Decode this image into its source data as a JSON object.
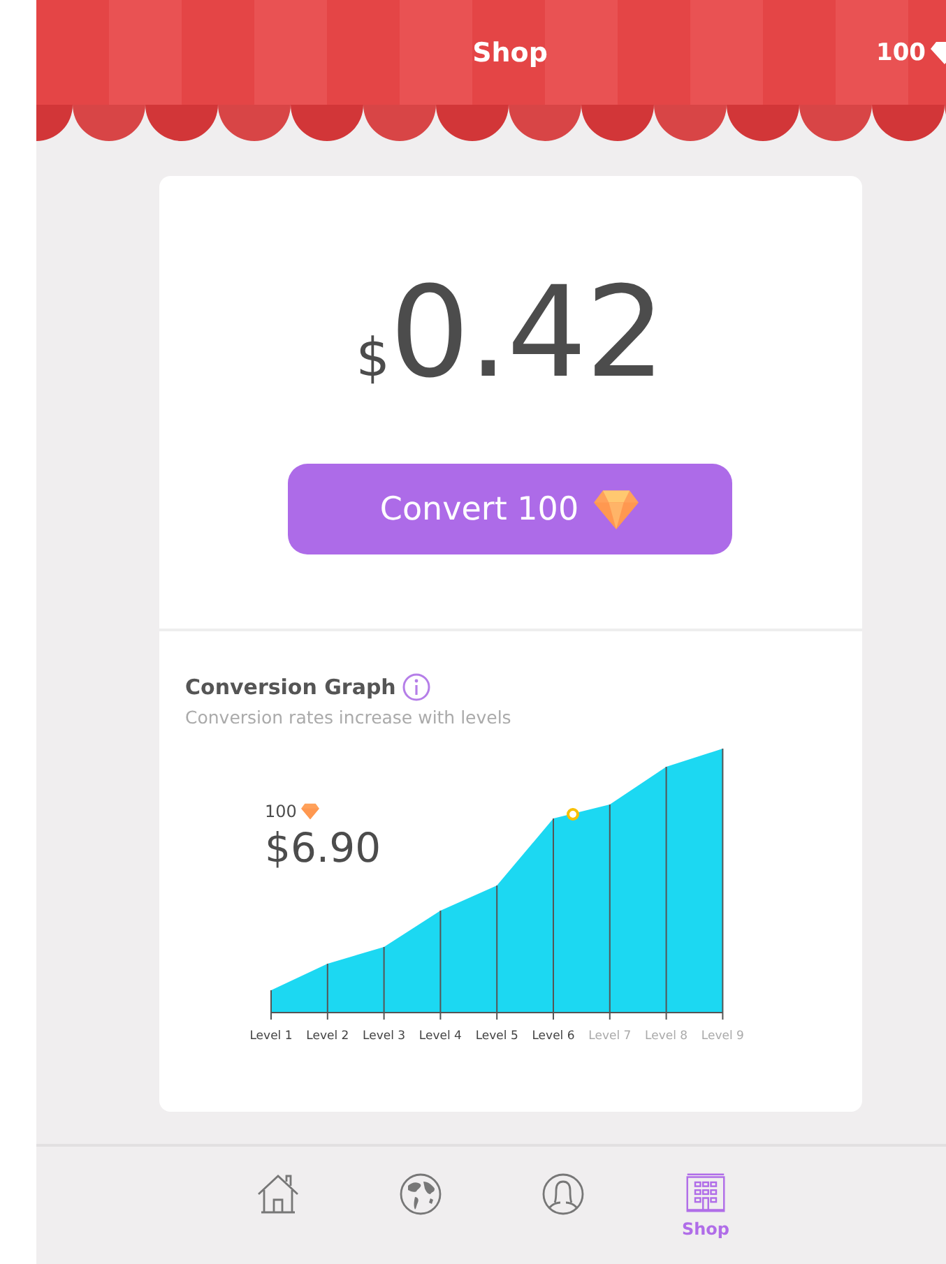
{
  "header": {
    "title": "Shop",
    "balance": "100"
  },
  "price": {
    "currency": "$",
    "amount": "0.42"
  },
  "convert_button": {
    "label": "Convert 100"
  },
  "graph": {
    "title": "Conversion Graph",
    "subtitle": "Conversion rates increase with levels",
    "callout_amount": "100",
    "callout_value": "$6.90",
    "levels": [
      {
        "label": "Level 1",
        "unlocked": true
      },
      {
        "label": "Level 2",
        "unlocked": true
      },
      {
        "label": "Level 3",
        "unlocked": true
      },
      {
        "label": "Level 4",
        "unlocked": true
      },
      {
        "label": "Level 5",
        "unlocked": true
      },
      {
        "label": "Level 6",
        "unlocked": true
      },
      {
        "label": "Level 7",
        "unlocked": false
      },
      {
        "label": "Level 8",
        "unlocked": false
      },
      {
        "label": "Level 9",
        "unlocked": false
      }
    ]
  },
  "nav": [
    {
      "kind": "home",
      "selected": false
    },
    {
      "kind": "globe",
      "selected": false
    },
    {
      "kind": "profile",
      "selected": false
    },
    {
      "kind": "shop",
      "selected": true,
      "label": "Shop"
    }
  ]
}
